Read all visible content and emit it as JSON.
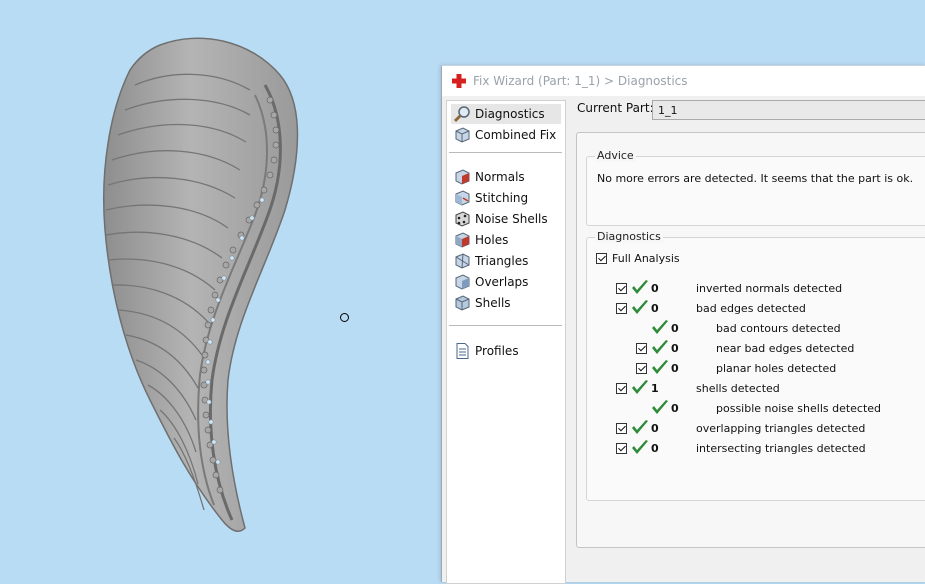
{
  "window": {
    "title": "Fix Wizard (Part: 1_1) > Diagnostics"
  },
  "nav": {
    "items": [
      {
        "label": "Diagnostics",
        "icon": "magnifier-icon"
      },
      {
        "label": "Combined Fix",
        "icon": "cube-icon"
      },
      {
        "label": "Normals",
        "icon": "normals-cube-icon"
      },
      {
        "label": "Stitching",
        "icon": "stitching-cube-icon"
      },
      {
        "label": "Noise Shells",
        "icon": "noise-shells-icon"
      },
      {
        "label": "Holes",
        "icon": "holes-cube-icon"
      },
      {
        "label": "Triangles",
        "icon": "triangles-cube-icon"
      },
      {
        "label": "Overlaps",
        "icon": "overlaps-cube-icon"
      },
      {
        "label": "Shells",
        "icon": "shells-cube-icon"
      }
    ],
    "profiles": {
      "label": "Profiles",
      "icon": "document-icon"
    }
  },
  "current_part": {
    "label": "Current Part:",
    "value": "1_1"
  },
  "advice": {
    "title": "Advice",
    "text": "No more errors are detected. It seems that the part is ok."
  },
  "diagnostics": {
    "title": "Diagnostics",
    "full_analysis_label": "Full Analysis",
    "rows": [
      {
        "count": "0",
        "label": "inverted normals detected"
      },
      {
        "count": "0",
        "label": "bad edges detected"
      },
      {
        "count": "0",
        "label": "bad contours detected"
      },
      {
        "count": "0",
        "label": "near bad edges detected"
      },
      {
        "count": "0",
        "label": "planar holes detected"
      },
      {
        "count": "1",
        "label": "shells detected"
      },
      {
        "count": "0",
        "label": "possible noise shells detected"
      },
      {
        "count": "0",
        "label": "overlapping triangles detected"
      },
      {
        "count": "0",
        "label": "intersecting triangles detected"
      }
    ]
  },
  "colors": {
    "viewport_bg": "#b9dcf5",
    "check_green": "#2e8b3a",
    "title_icon_red": "#d62020"
  }
}
